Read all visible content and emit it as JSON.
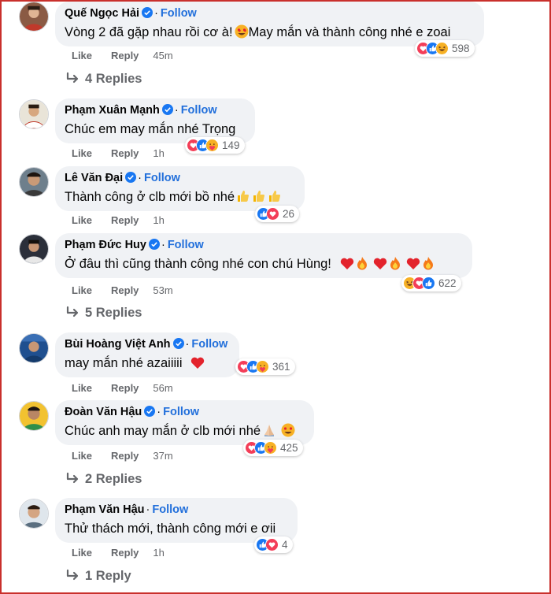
{
  "follow_label": "Follow",
  "like_label": "Like",
  "reply_label": "Reply",
  "comments": [
    {
      "author": "Quế Ngọc Hải",
      "text": "Vòng 2 đã gặp nhau rồi cơ à!",
      "text_after": "May mắn và thành công nhé e zoai",
      "emojis": [
        "heart-eyes-emoji"
      ],
      "reactions": [
        "love",
        "like",
        "haha"
      ],
      "reaction_count": "598",
      "time": "45m",
      "replies_label": "4 Replies"
    },
    {
      "author": "Phạm Xuân Mạnh",
      "text": "Chúc em may mắn nhé Trọng",
      "reactions": [
        "love",
        "like",
        "care"
      ],
      "reaction_count": "149",
      "time": "1h"
    },
    {
      "author": "Lê Văn Đại",
      "text": "Thành công ở clb mới bồ nhé",
      "emojis": [
        "thumbs-up-emoji",
        "thumbs-up-emoji",
        "thumbs-up-emoji"
      ],
      "reactions": [
        "like",
        "love"
      ],
      "reaction_count": "26",
      "time": "1h"
    },
    {
      "author": "Phạm Đức Huy",
      "text": "Ở đâu thì cũng thành công nhé con chú Hùng!",
      "emojis": [
        "red-heart-emoji",
        "fire-emoji",
        "red-heart-emoji",
        "fire-emoji",
        "red-heart-emoji",
        "fire-emoji"
      ],
      "reactions": [
        "haha",
        "love",
        "like"
      ],
      "reaction_count": "622",
      "time": "53m",
      "replies_label": "5 Replies"
    },
    {
      "author": "Bùi Hoàng Việt Anh",
      "text": "may mắn nhé azaiiiii",
      "emojis": [
        "red-heart-emoji"
      ],
      "reactions": [
        "love",
        "like",
        "care"
      ],
      "reaction_count": "361",
      "time": "56m"
    },
    {
      "author": "Đoàn Văn Hậu",
      "text": "Chúc anh may mắn ở clb mới nhé",
      "emojis": [
        "folded-hands-emoji",
        "heart-eyes-emoji"
      ],
      "reactions": [
        "love",
        "like",
        "care"
      ],
      "reaction_count": "425",
      "time": "37m",
      "replies_label": "2 Replies"
    },
    {
      "author": "Phạm Văn Hậu",
      "text": "Thử thách mới, thành công mới e ơii",
      "reactions": [
        "like",
        "love"
      ],
      "reaction_count": "4",
      "time": "1h",
      "replies_label": "1 Reply"
    }
  ],
  "colors": {
    "bubble": "#f0f2f5",
    "follow": "#216fdb",
    "secondary_text": "#65676b",
    "like_blue": "#1877f2",
    "love_red": "#f33e58",
    "haha_yellow": "#f7b125",
    "frame_border": "#c9302c"
  }
}
